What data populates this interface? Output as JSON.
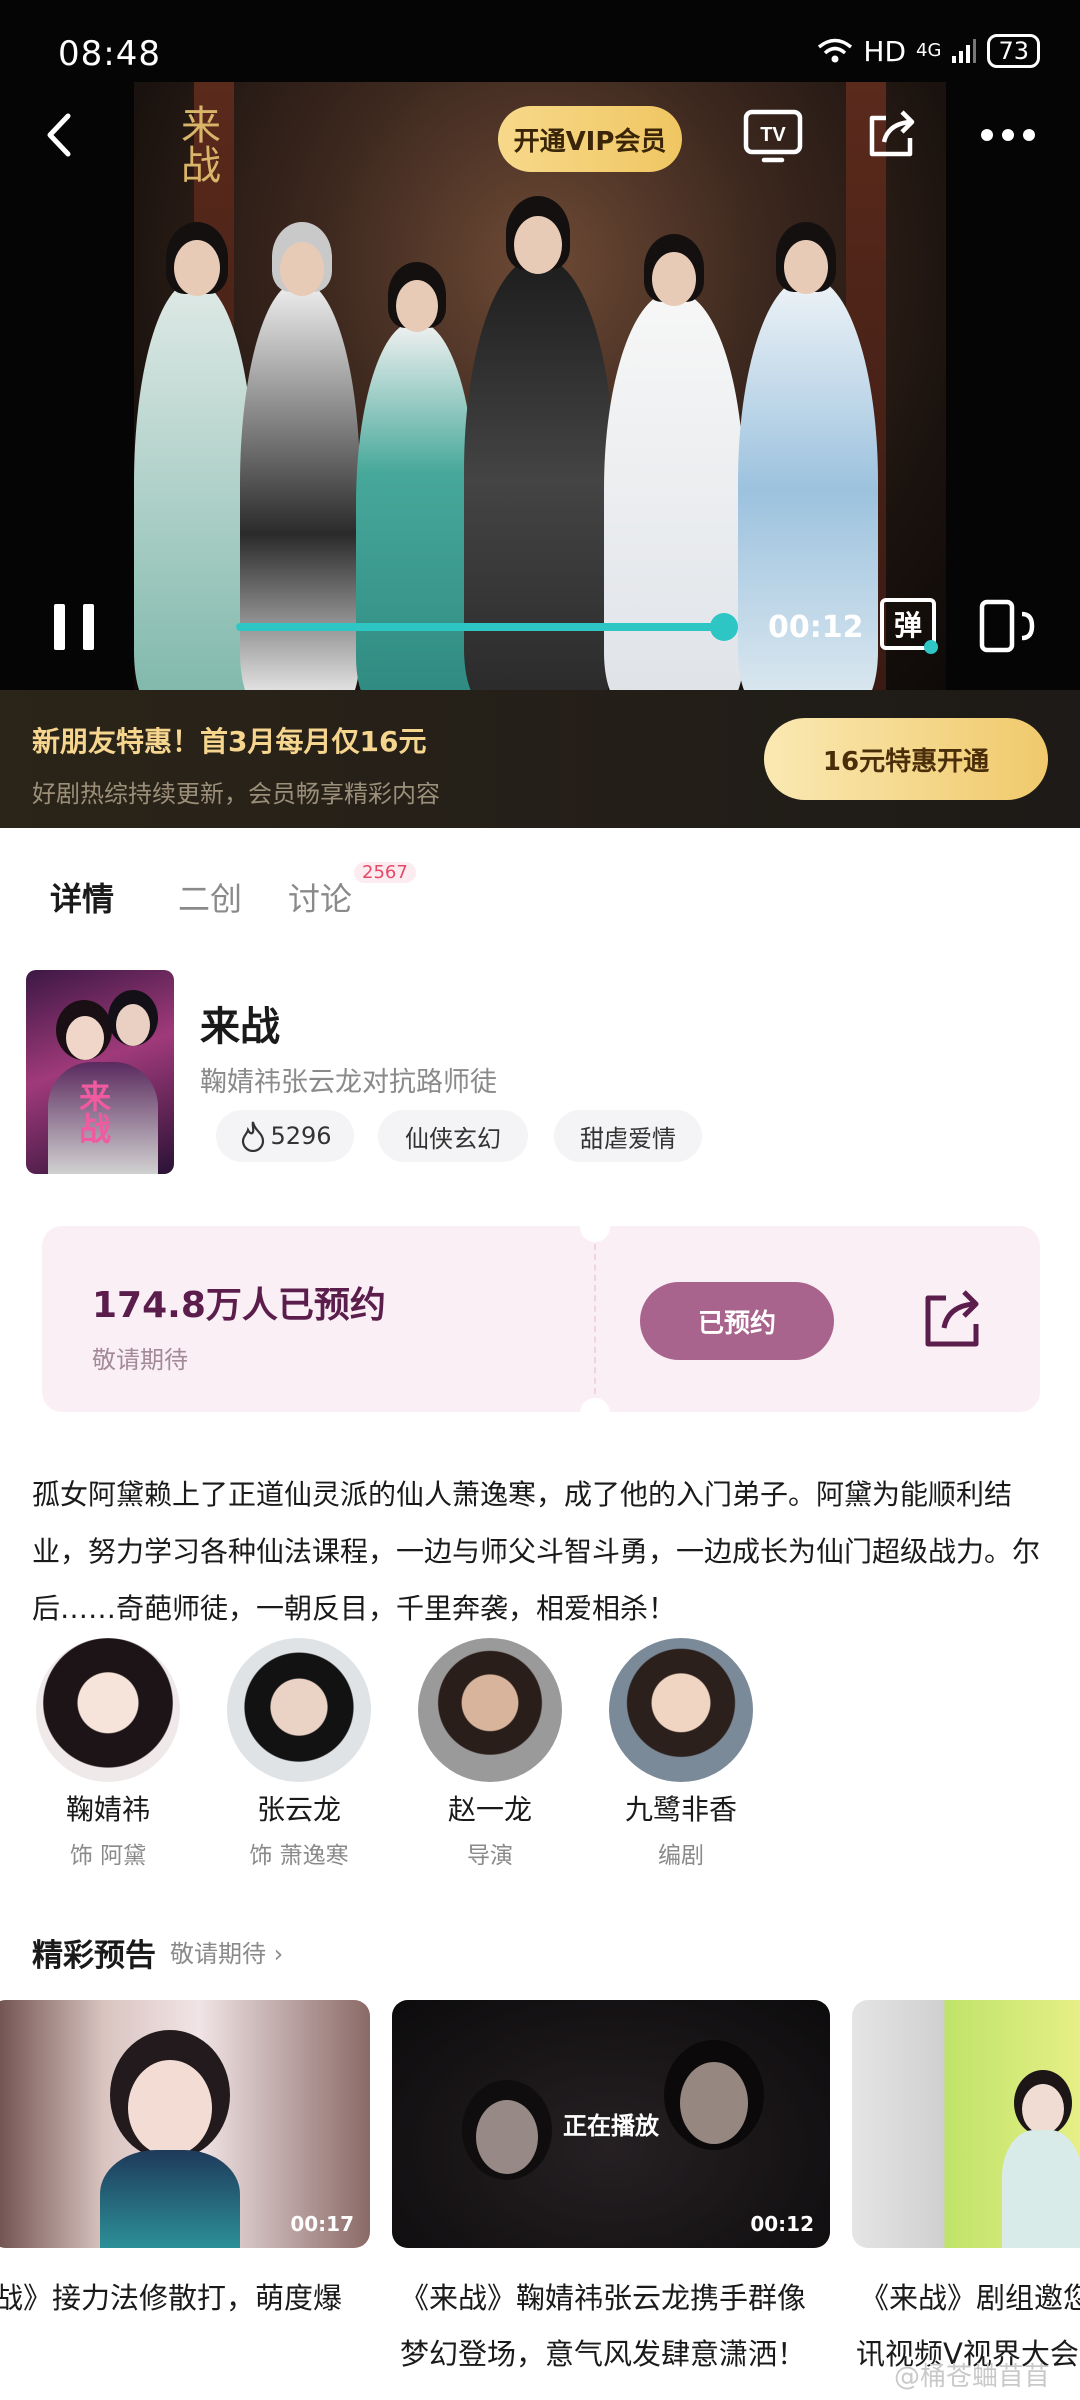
{
  "status_bar": {
    "time": "08:48",
    "network": "HD",
    "signal": "4G",
    "battery": "73"
  },
  "player": {
    "vip_button": "开通VIP会员",
    "current_time": "00:12",
    "danmaku_label": "弹",
    "progress": 1.0
  },
  "promo": {
    "title": "新朋友特惠！首3月每月仅16元",
    "subtitle": "好剧热综持续更新，会员畅享精彩内容",
    "button": "16元特惠开通"
  },
  "tabs": [
    {
      "label": "详情",
      "active": true
    },
    {
      "label": "二创",
      "active": false
    },
    {
      "label": "讨论",
      "active": false,
      "badge": "2567"
    }
  ],
  "show": {
    "title": "来战",
    "subtitle": "鞠婧祎张云龙对抗路师徒",
    "heat": "5296",
    "tags": [
      "仙侠玄幻",
      "甜虐爱情"
    ],
    "poster_text": "来战"
  },
  "reservation": {
    "count": "174.8万人已预约",
    "subtitle": "敬请期待",
    "button": "已预约"
  },
  "synopsis": "孤女阿黛赖上了正道仙灵派的仙人萧逸寒，成了他的入门弟子。阿黛为能顺利结业，努力学习各种仙法课程，一边与师父斗智斗勇，一边成长为仙门超级战力。尔后……奇葩师徒，一朝反目，千里奔袭，相爱相杀！",
  "cast": [
    {
      "name": "鞠婧祎",
      "role": "饰  阿黛"
    },
    {
      "name": "张云龙",
      "role": "饰  萧逸寒"
    },
    {
      "name": "赵一龙",
      "role": "导演"
    },
    {
      "name": "九鹭非香",
      "role": "编剧"
    }
  ],
  "trailers": {
    "section_title": "精彩预告",
    "section_more": "敬请期待",
    "items": [
      {
        "duration": "00:17",
        "line1": "战》接力法修散打，萌度爆",
        "line2": ""
      },
      {
        "duration": "00:12",
        "overlay": "正在播放",
        "line1": "《来战》鞠婧祎张云龙携手群像",
        "line2": "梦幻登场，意气风发肆意潇洒！"
      },
      {
        "duration": "",
        "line1": "《来战》剧组邀您",
        "line2": "讯视频V视界大会"
      }
    ]
  },
  "watermark": "@桶苍蛐苜苜",
  "colors": {
    "accent_teal": "#2ec5c5",
    "vip_gold": "#f0c662",
    "reserve_purple": "#a8648c"
  }
}
